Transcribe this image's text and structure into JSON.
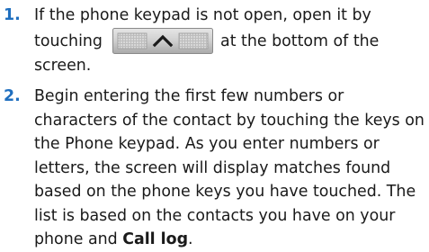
{
  "steps": [
    {
      "number": "1.",
      "text_before": "If the phone keypad is not open, open it by touching",
      "text_after": "at the bottom of the screen."
    },
    {
      "number": "2.",
      "text": "Begin entering the first few numbers or characters of the contact by touching the keys on the Phone keypad. As you enter numbers or letters, the screen will display matches found based on the phone keys you have touched. The list is based on the contacts you have on your phone and",
      "emphasis": "Call log",
      "end": "."
    }
  ],
  "colors": {
    "step_number": "#1f6fbf",
    "text": "#1a1a1a",
    "button_face": "#c9c9c9",
    "button_border": "#8a8a8a"
  },
  "icons": {
    "keypad_button": "chevron-up-icon"
  }
}
